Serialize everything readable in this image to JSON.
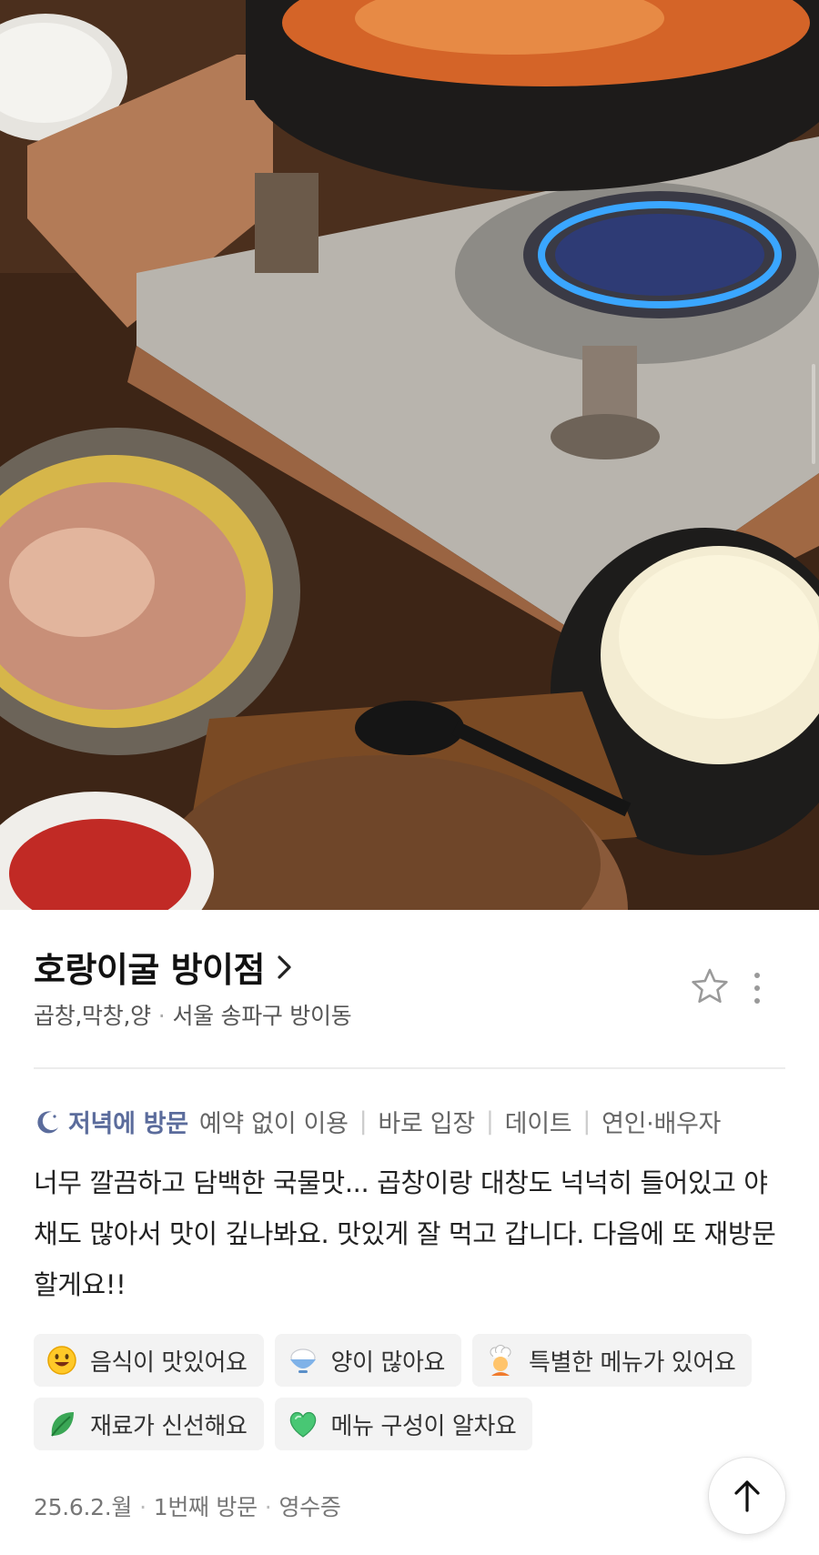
{
  "photo": {
    "icon": "food-photo"
  },
  "place": {
    "name": "호랑이굴 방이점",
    "category": "곱창,막창,양",
    "location": "서울 송파구 방이동"
  },
  "visit": {
    "time": "저녁에 방문",
    "tags": [
      "예약 없이 이용",
      "바로 입장",
      "데이트",
      "연인·배우자"
    ]
  },
  "review": {
    "text": "너무 깔끔하고 담백한 국물맛... 곱창이랑 대창도 넉넉히 들어있고 야채도 많아서 맛이 깊나봐요. 맛있게 잘 먹고 갑니다. 다음에 또 재방문할게요!!"
  },
  "keywords": [
    {
      "label": "음식이 맛있어요",
      "icon": "smile-emoji-icon"
    },
    {
      "label": "양이 많아요",
      "icon": "rice-bowl-icon"
    },
    {
      "label": "특별한 메뉴가 있어요",
      "icon": "chef-icon"
    },
    {
      "label": "재료가 신선해요",
      "icon": "leaf-icon"
    },
    {
      "label": "메뉴 구성이 알차요",
      "icon": "heart-icon"
    }
  ],
  "footer": {
    "date": "25.6.2.월",
    "visit_count": "1번째 방문",
    "verification": "영수증"
  },
  "colors": {
    "accent_visit": "#5b6c9c",
    "chip_bg": "#f3f3f3"
  }
}
